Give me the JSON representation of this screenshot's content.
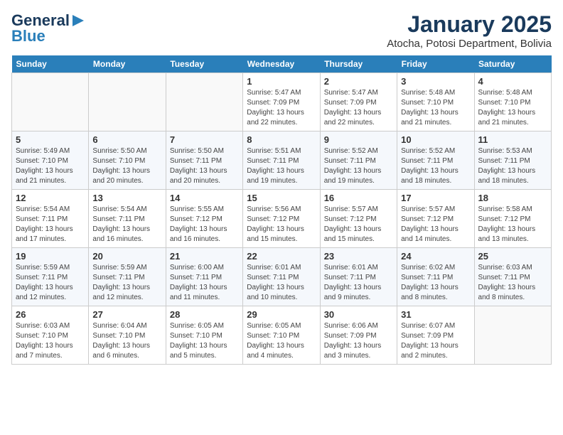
{
  "logo": {
    "line1": "General",
    "line2": "Blue"
  },
  "title": "January 2025",
  "subtitle": "Atocha, Potosi Department, Bolivia",
  "weekdays": [
    "Sunday",
    "Monday",
    "Tuesday",
    "Wednesday",
    "Thursday",
    "Friday",
    "Saturday"
  ],
  "weeks": [
    [
      {
        "day": "",
        "info": ""
      },
      {
        "day": "",
        "info": ""
      },
      {
        "day": "",
        "info": ""
      },
      {
        "day": "1",
        "info": "Sunrise: 5:47 AM\nSunset: 7:09 PM\nDaylight: 13 hours\nand 22 minutes."
      },
      {
        "day": "2",
        "info": "Sunrise: 5:47 AM\nSunset: 7:09 PM\nDaylight: 13 hours\nand 22 minutes."
      },
      {
        "day": "3",
        "info": "Sunrise: 5:48 AM\nSunset: 7:10 PM\nDaylight: 13 hours\nand 21 minutes."
      },
      {
        "day": "4",
        "info": "Sunrise: 5:48 AM\nSunset: 7:10 PM\nDaylight: 13 hours\nand 21 minutes."
      }
    ],
    [
      {
        "day": "5",
        "info": "Sunrise: 5:49 AM\nSunset: 7:10 PM\nDaylight: 13 hours\nand 21 minutes."
      },
      {
        "day": "6",
        "info": "Sunrise: 5:50 AM\nSunset: 7:10 PM\nDaylight: 13 hours\nand 20 minutes."
      },
      {
        "day": "7",
        "info": "Sunrise: 5:50 AM\nSunset: 7:11 PM\nDaylight: 13 hours\nand 20 minutes."
      },
      {
        "day": "8",
        "info": "Sunrise: 5:51 AM\nSunset: 7:11 PM\nDaylight: 13 hours\nand 19 minutes."
      },
      {
        "day": "9",
        "info": "Sunrise: 5:52 AM\nSunset: 7:11 PM\nDaylight: 13 hours\nand 19 minutes."
      },
      {
        "day": "10",
        "info": "Sunrise: 5:52 AM\nSunset: 7:11 PM\nDaylight: 13 hours\nand 18 minutes."
      },
      {
        "day": "11",
        "info": "Sunrise: 5:53 AM\nSunset: 7:11 PM\nDaylight: 13 hours\nand 18 minutes."
      }
    ],
    [
      {
        "day": "12",
        "info": "Sunrise: 5:54 AM\nSunset: 7:11 PM\nDaylight: 13 hours\nand 17 minutes."
      },
      {
        "day": "13",
        "info": "Sunrise: 5:54 AM\nSunset: 7:11 PM\nDaylight: 13 hours\nand 16 minutes."
      },
      {
        "day": "14",
        "info": "Sunrise: 5:55 AM\nSunset: 7:12 PM\nDaylight: 13 hours\nand 16 minutes."
      },
      {
        "day": "15",
        "info": "Sunrise: 5:56 AM\nSunset: 7:12 PM\nDaylight: 13 hours\nand 15 minutes."
      },
      {
        "day": "16",
        "info": "Sunrise: 5:57 AM\nSunset: 7:12 PM\nDaylight: 13 hours\nand 15 minutes."
      },
      {
        "day": "17",
        "info": "Sunrise: 5:57 AM\nSunset: 7:12 PM\nDaylight: 13 hours\nand 14 minutes."
      },
      {
        "day": "18",
        "info": "Sunrise: 5:58 AM\nSunset: 7:12 PM\nDaylight: 13 hours\nand 13 minutes."
      }
    ],
    [
      {
        "day": "19",
        "info": "Sunrise: 5:59 AM\nSunset: 7:11 PM\nDaylight: 13 hours\nand 12 minutes."
      },
      {
        "day": "20",
        "info": "Sunrise: 5:59 AM\nSunset: 7:11 PM\nDaylight: 13 hours\nand 12 minutes."
      },
      {
        "day": "21",
        "info": "Sunrise: 6:00 AM\nSunset: 7:11 PM\nDaylight: 13 hours\nand 11 minutes."
      },
      {
        "day": "22",
        "info": "Sunrise: 6:01 AM\nSunset: 7:11 PM\nDaylight: 13 hours\nand 10 minutes."
      },
      {
        "day": "23",
        "info": "Sunrise: 6:01 AM\nSunset: 7:11 PM\nDaylight: 13 hours\nand 9 minutes."
      },
      {
        "day": "24",
        "info": "Sunrise: 6:02 AM\nSunset: 7:11 PM\nDaylight: 13 hours\nand 8 minutes."
      },
      {
        "day": "25",
        "info": "Sunrise: 6:03 AM\nSunset: 7:11 PM\nDaylight: 13 hours\nand 8 minutes."
      }
    ],
    [
      {
        "day": "26",
        "info": "Sunrise: 6:03 AM\nSunset: 7:10 PM\nDaylight: 13 hours\nand 7 minutes."
      },
      {
        "day": "27",
        "info": "Sunrise: 6:04 AM\nSunset: 7:10 PM\nDaylight: 13 hours\nand 6 minutes."
      },
      {
        "day": "28",
        "info": "Sunrise: 6:05 AM\nSunset: 7:10 PM\nDaylight: 13 hours\nand 5 minutes."
      },
      {
        "day": "29",
        "info": "Sunrise: 6:05 AM\nSunset: 7:10 PM\nDaylight: 13 hours\nand 4 minutes."
      },
      {
        "day": "30",
        "info": "Sunrise: 6:06 AM\nSunset: 7:09 PM\nDaylight: 13 hours\nand 3 minutes."
      },
      {
        "day": "31",
        "info": "Sunrise: 6:07 AM\nSunset: 7:09 PM\nDaylight: 13 hours\nand 2 minutes."
      },
      {
        "day": "",
        "info": ""
      }
    ]
  ]
}
